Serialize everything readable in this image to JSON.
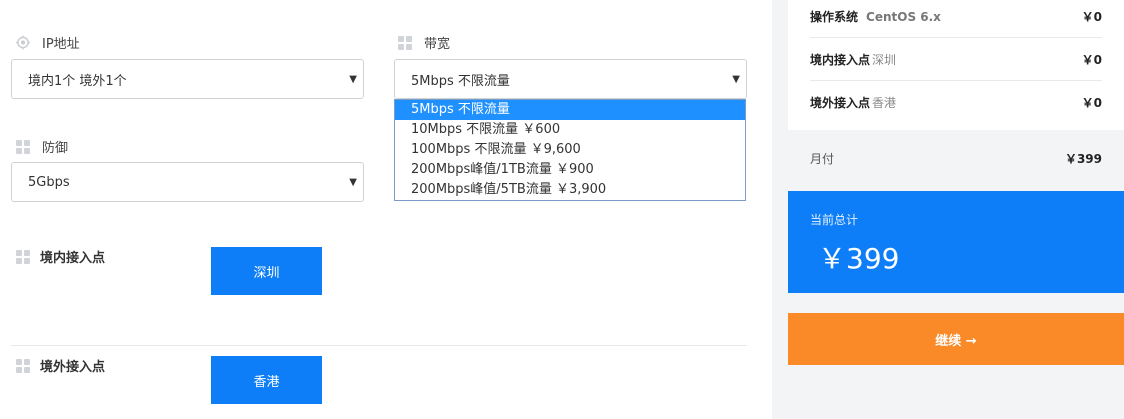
{
  "form": {
    "ip": {
      "label": "IP地址",
      "value": "境内1个 境外1个"
    },
    "bandwidth": {
      "label": "带宽",
      "value": "5Mbps 不限流量",
      "options": [
        "5Mbps 不限流量",
        "10Mbps 不限流量 ￥600",
        "100Mbps 不限流量 ￥9,600",
        "200Mbps峰值/1TB流量 ￥900",
        "200Mbps峰值/5TB流量 ￥3,900"
      ],
      "selected_index": 0
    },
    "defense": {
      "label": "防御",
      "value": "5Gbps"
    },
    "domestic_access": {
      "label": "境内接入点",
      "button": "深圳"
    },
    "overseas_access": {
      "label": "境外接入点",
      "button": "香港"
    }
  },
  "summary": {
    "rows": [
      {
        "key": "操作系统",
        "detail": "CentOS 6.x",
        "value": "￥0"
      },
      {
        "key": "境内接入点",
        "detail": "深圳",
        "value": "￥0"
      },
      {
        "key": "境外接入点",
        "detail": "香港",
        "value": "￥0"
      }
    ],
    "monthly": {
      "label": "月付",
      "value": "￥399"
    },
    "total": {
      "label": "当前总计",
      "value": "￥399"
    },
    "continue_label": "继续 →"
  },
  "colors": {
    "primary": "#0d7ef7",
    "accent": "#fa8a28",
    "panel_bg": "#f3f4f6",
    "dropdown_highlight": "#1e90ff"
  },
  "icons": {
    "ip": "location-target-icon",
    "grid": "grid-icon",
    "caret": "caret-down-icon"
  }
}
